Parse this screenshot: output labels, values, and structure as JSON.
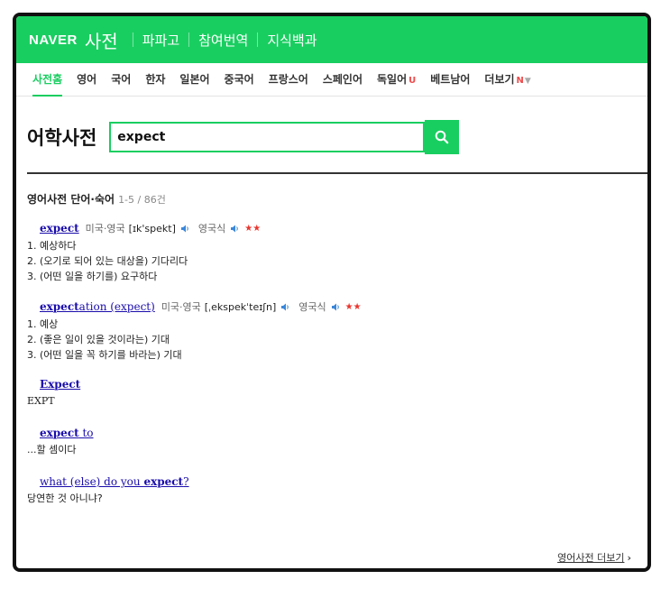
{
  "header": {
    "logo": "NAVER",
    "service": "사전",
    "nav": [
      "파파고",
      "참여번역",
      "지식백과"
    ]
  },
  "subnav": {
    "tabs": [
      "사전홈",
      "영어",
      "국어",
      "한자",
      "일본어",
      "중국어",
      "프랑스어",
      "스페인어",
      "독일어",
      "베트남어",
      "더보기"
    ],
    "badges": {
      "german": "U",
      "more": "N"
    }
  },
  "search": {
    "title": "어학사전",
    "query": "expect"
  },
  "results": {
    "section_title": "영어사전 단어·숙어",
    "count": "1-5 / 86건",
    "entries": [
      {
        "word_bold": "expect",
        "word_rest": "",
        "pron_label_1": "미국·영국",
        "ipa": "[ɪk'spekt]",
        "pron_label_2": "영국식",
        "stars": "★★",
        "meanings": [
          "1. 예상하다",
          "2. (오기로 되어 있는 대상을) 기다리다",
          "3. (어떤 일을 하기를) 요구하다"
        ]
      },
      {
        "word_bold": "expect",
        "word_rest": "ation (expect)",
        "pron_label_1": "미국·영국",
        "ipa": "[ˌekspekˈteɪʃn]",
        "pron_label_2": "영국식",
        "stars": "★★",
        "meanings": [
          "1. 예상",
          "2. (좋은 일이 있을 것이라는) 기대",
          "3. (어떤 일을 꼭 하기를 바라는) 기대"
        ]
      },
      {
        "word": "Expect",
        "meanings": [
          "EXPT"
        ]
      },
      {
        "word_pre": "",
        "word_bold": "expect",
        "word_rest": " to",
        "meanings": [
          "...할 셈이다"
        ]
      },
      {
        "word_pre": "what (else) do you ",
        "word_bold": "expect",
        "word_rest": "?",
        "meanings": [
          "당연한 것 아니냐?"
        ]
      }
    ]
  },
  "footer": {
    "more_link": "영어사전 더보기"
  },
  "colors": {
    "brand_green": "#19ce60",
    "link_blue": "#1a0dab",
    "star_red": "#e8362f"
  }
}
